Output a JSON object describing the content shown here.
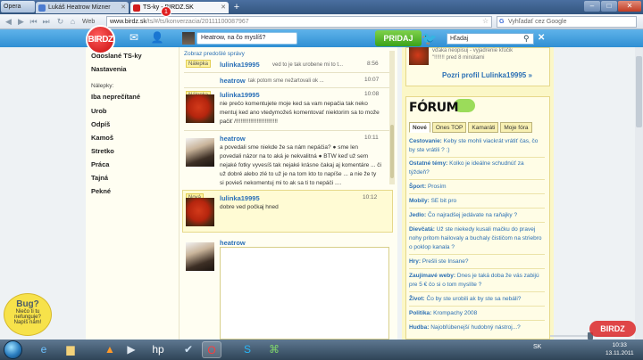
{
  "browser": {
    "menu_label": "Opera",
    "tabs": [
      {
        "title": "Lukáš Heatrow Mizner"
      },
      {
        "title": "TS-ky - BIRDZ.SK"
      }
    ],
    "web_label": "Web",
    "url_host": "www.birdz.sk",
    "url_path": "/ts/#/ts/konverzacia/20111100087967",
    "search_placeholder": "Vyhľadať cez Google"
  },
  "site": {
    "logo_text": "BIRDZ",
    "notification_count": "1",
    "status_placeholder": "Heatrow, na čo myslíš?",
    "post_button": "PRIDAJ",
    "search_placeholder": "Hľadaj"
  },
  "sidebar": {
    "top_items": [
      "Odoslané TS-ky",
      "Nastavenia"
    ],
    "labels_heading": "Nálepky:",
    "labels": [
      "Iba neprečítané",
      "Urob",
      "Odpíš",
      "Kamoš",
      "Stretko",
      "Práca",
      "Tajná",
      "Pekné"
    ],
    "bug_title": "Bug?",
    "bug_text_1": "Niečo ti tu",
    "bug_text_2": "nefunguje?",
    "bug_text_3": "Napíš nám!"
  },
  "conversation": {
    "previous_link": "Zobraz predošlé správy",
    "messages": [
      {
        "badge": "Nálepka",
        "author": "lulinka19995",
        "preview": "ved to je tak urobene mi to t...",
        "time": "8:56"
      },
      {
        "author": "heatrow",
        "preview": "tak potom sme nežartovali ok ...",
        "time": "10:07"
      },
      {
        "badge": "Nálepka",
        "author": "lulinka19995",
        "time": "10:08",
        "lines": [
          "nie prečo komentujete moje ked sa vam nepačia tak neko",
          "mentuj ked ano vtedymožeš komentovať niektorim sa to može",
          "pačiť /!!!!!!!!!!!!!!!!!!!!!!!!!!"
        ]
      },
      {
        "author": "heatrow",
        "time": "10:11",
        "lines": [
          "a povedali sme niekde že sa nám nepáčia? ● sme len",
          "povedali názor na to aká je nekvalitná ● BTW keď už sem",
          "nejaké fotky vyvesíš tak nejaké krásne čakaj aj komentáre ... či",
          "už dobré alebo zlé to už je na tom kto to napíše ... a nie že ty",
          "si povieš nekomentuj mi to ak sa ti to nepáči ...."
        ]
      },
      {
        "badge": "Nová",
        "author": "lulinka19995",
        "time": "10:12",
        "lines": [
          "dobre ved počkaj hned"
        ]
      }
    ],
    "reply_author": "heatrow"
  },
  "right": {
    "profile_text_1": "...",
    "profile_text_2": "vďaka neopisuj - vyjadrenie kľúčik",
    "profile_text_3": "\"!!!!!!!   pred 8 minútami",
    "profile_link": "Pozri profil Lulinka19995 »",
    "forum_title": "FÓRUM",
    "forum_tabs": [
      "Nové",
      "Ones TOP",
      "Kamaráti",
      "Moje fóra"
    ],
    "forum_rows": [
      {
        "cat": "Cestovanie:",
        "text": "Keby ste mohli viackrát vrátiť čas, čo by ste vrátili ? :)"
      },
      {
        "cat": "Ostatné témy:",
        "text": "Kolko je ideálne schudnúť za týždeň?"
      },
      {
        "cat": "Šport:",
        "text": "Prosím"
      },
      {
        "cat": "Mobily:",
        "text": "SE bit pro"
      },
      {
        "cat": "Jedlo:",
        "text": "Čo najradšej jedávate na raňajky ?"
      },
      {
        "cat": "Dievčatá:",
        "text": "Už ste niekedy kusali mačku do pravej nohy pritom hailovaly a buchaly čističom na striebro o poklop kanala ?"
      },
      {
        "cat": "Hry:",
        "text": "Prešli ste Insane?"
      },
      {
        "cat": "Zaujímavé weby:",
        "text": "Dnes je taká doba že vás zabijú pre 5 € čo si o tom myslíte ?"
      },
      {
        "cat": "Život:",
        "text": "Čo by ste urobili ak by ste sa nebáli?"
      },
      {
        "cat": "Politika:",
        "text": "Krompachy 2008"
      },
      {
        "cat": "Hudba:",
        "text": "Najobľúbenejší hudobný nástroj...?"
      }
    ]
  },
  "taskbar": {
    "lang": "SK",
    "time": "10:33",
    "date": "13.11.2011",
    "watermark": "BIRDZ"
  },
  "colors": {
    "header_blue": "#2f8fd3",
    "logo_red": "#c80e0e",
    "link_blue": "#2a6fb4",
    "forum_bg": "#fbf7c7",
    "post_green": "#3ba21a"
  }
}
